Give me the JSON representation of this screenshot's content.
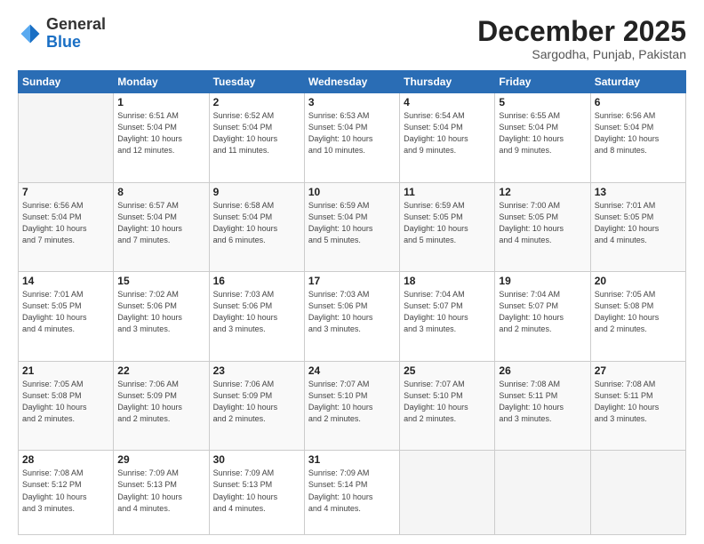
{
  "header": {
    "logo_general": "General",
    "logo_blue": "Blue",
    "month_year": "December 2025",
    "location": "Sargodha, Punjab, Pakistan"
  },
  "days_of_week": [
    "Sunday",
    "Monday",
    "Tuesday",
    "Wednesday",
    "Thursday",
    "Friday",
    "Saturday"
  ],
  "weeks": [
    [
      {
        "day": "",
        "info": ""
      },
      {
        "day": "1",
        "info": "Sunrise: 6:51 AM\nSunset: 5:04 PM\nDaylight: 10 hours\nand 12 minutes."
      },
      {
        "day": "2",
        "info": "Sunrise: 6:52 AM\nSunset: 5:04 PM\nDaylight: 10 hours\nand 11 minutes."
      },
      {
        "day": "3",
        "info": "Sunrise: 6:53 AM\nSunset: 5:04 PM\nDaylight: 10 hours\nand 10 minutes."
      },
      {
        "day": "4",
        "info": "Sunrise: 6:54 AM\nSunset: 5:04 PM\nDaylight: 10 hours\nand 9 minutes."
      },
      {
        "day": "5",
        "info": "Sunrise: 6:55 AM\nSunset: 5:04 PM\nDaylight: 10 hours\nand 9 minutes."
      },
      {
        "day": "6",
        "info": "Sunrise: 6:56 AM\nSunset: 5:04 PM\nDaylight: 10 hours\nand 8 minutes."
      }
    ],
    [
      {
        "day": "7",
        "info": "Sunrise: 6:56 AM\nSunset: 5:04 PM\nDaylight: 10 hours\nand 7 minutes."
      },
      {
        "day": "8",
        "info": "Sunrise: 6:57 AM\nSunset: 5:04 PM\nDaylight: 10 hours\nand 7 minutes."
      },
      {
        "day": "9",
        "info": "Sunrise: 6:58 AM\nSunset: 5:04 PM\nDaylight: 10 hours\nand 6 minutes."
      },
      {
        "day": "10",
        "info": "Sunrise: 6:59 AM\nSunset: 5:04 PM\nDaylight: 10 hours\nand 5 minutes."
      },
      {
        "day": "11",
        "info": "Sunrise: 6:59 AM\nSunset: 5:05 PM\nDaylight: 10 hours\nand 5 minutes."
      },
      {
        "day": "12",
        "info": "Sunrise: 7:00 AM\nSunset: 5:05 PM\nDaylight: 10 hours\nand 4 minutes."
      },
      {
        "day": "13",
        "info": "Sunrise: 7:01 AM\nSunset: 5:05 PM\nDaylight: 10 hours\nand 4 minutes."
      }
    ],
    [
      {
        "day": "14",
        "info": "Sunrise: 7:01 AM\nSunset: 5:05 PM\nDaylight: 10 hours\nand 4 minutes."
      },
      {
        "day": "15",
        "info": "Sunrise: 7:02 AM\nSunset: 5:06 PM\nDaylight: 10 hours\nand 3 minutes."
      },
      {
        "day": "16",
        "info": "Sunrise: 7:03 AM\nSunset: 5:06 PM\nDaylight: 10 hours\nand 3 minutes."
      },
      {
        "day": "17",
        "info": "Sunrise: 7:03 AM\nSunset: 5:06 PM\nDaylight: 10 hours\nand 3 minutes."
      },
      {
        "day": "18",
        "info": "Sunrise: 7:04 AM\nSunset: 5:07 PM\nDaylight: 10 hours\nand 3 minutes."
      },
      {
        "day": "19",
        "info": "Sunrise: 7:04 AM\nSunset: 5:07 PM\nDaylight: 10 hours\nand 2 minutes."
      },
      {
        "day": "20",
        "info": "Sunrise: 7:05 AM\nSunset: 5:08 PM\nDaylight: 10 hours\nand 2 minutes."
      }
    ],
    [
      {
        "day": "21",
        "info": "Sunrise: 7:05 AM\nSunset: 5:08 PM\nDaylight: 10 hours\nand 2 minutes."
      },
      {
        "day": "22",
        "info": "Sunrise: 7:06 AM\nSunset: 5:09 PM\nDaylight: 10 hours\nand 2 minutes."
      },
      {
        "day": "23",
        "info": "Sunrise: 7:06 AM\nSunset: 5:09 PM\nDaylight: 10 hours\nand 2 minutes."
      },
      {
        "day": "24",
        "info": "Sunrise: 7:07 AM\nSunset: 5:10 PM\nDaylight: 10 hours\nand 2 minutes."
      },
      {
        "day": "25",
        "info": "Sunrise: 7:07 AM\nSunset: 5:10 PM\nDaylight: 10 hours\nand 2 minutes."
      },
      {
        "day": "26",
        "info": "Sunrise: 7:08 AM\nSunset: 5:11 PM\nDaylight: 10 hours\nand 3 minutes."
      },
      {
        "day": "27",
        "info": "Sunrise: 7:08 AM\nSunset: 5:11 PM\nDaylight: 10 hours\nand 3 minutes."
      }
    ],
    [
      {
        "day": "28",
        "info": "Sunrise: 7:08 AM\nSunset: 5:12 PM\nDaylight: 10 hours\nand 3 minutes."
      },
      {
        "day": "29",
        "info": "Sunrise: 7:09 AM\nSunset: 5:13 PM\nDaylight: 10 hours\nand 4 minutes."
      },
      {
        "day": "30",
        "info": "Sunrise: 7:09 AM\nSunset: 5:13 PM\nDaylight: 10 hours\nand 4 minutes."
      },
      {
        "day": "31",
        "info": "Sunrise: 7:09 AM\nSunset: 5:14 PM\nDaylight: 10 hours\nand 4 minutes."
      },
      {
        "day": "",
        "info": ""
      },
      {
        "day": "",
        "info": ""
      },
      {
        "day": "",
        "info": ""
      }
    ]
  ]
}
